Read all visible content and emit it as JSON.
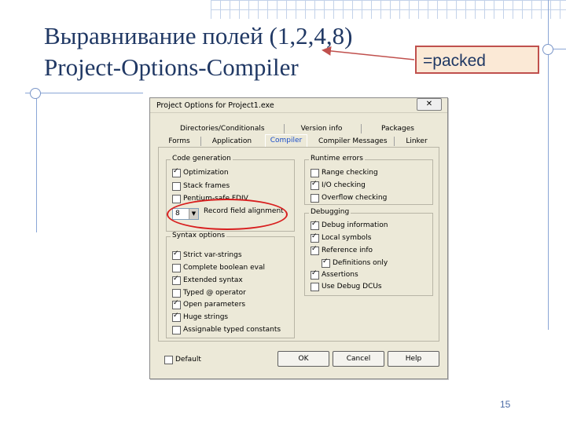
{
  "slide": {
    "title_line1": "Выравнивание полей (1,2,4,8)",
    "title_line2": "Project-Options-Compiler",
    "callout": "=packed",
    "page_number": "15",
    "colors": {
      "title": "#203864",
      "callout_border": "#c0504d",
      "callout_fill": "#fbe9d6",
      "highlight": "#d81e1e"
    }
  },
  "dialog": {
    "title": "Project Options for Project1.exe",
    "close_label": "✕",
    "tabs_row1": [
      "Directories/Conditionals",
      "Version info",
      "Packages"
    ],
    "tabs_row2": [
      "Forms",
      "Application",
      "Compiler",
      "Compiler Messages",
      "Linker"
    ],
    "active_tab": "Compiler",
    "code_generation": {
      "title": "Code generation",
      "items": [
        {
          "label": "Optimization",
          "checked": true
        },
        {
          "label": "Stack frames",
          "checked": false
        },
        {
          "label": "Pentium-safe FDIV",
          "checked": false
        }
      ],
      "alignment_value": "8",
      "alignment_label": "Record field alignment"
    },
    "syntax_options": {
      "title": "Syntax options",
      "items": [
        {
          "label": "Strict var-strings",
          "checked": true
        },
        {
          "label": "Complete boolean eval",
          "checked": false
        },
        {
          "label": "Extended syntax",
          "checked": true
        },
        {
          "label": "Typed @ operator",
          "checked": false
        },
        {
          "label": "Open parameters",
          "checked": true
        },
        {
          "label": "Huge strings",
          "checked": true
        },
        {
          "label": "Assignable typed constants",
          "checked": false
        }
      ]
    },
    "runtime_errors": {
      "title": "Runtime errors",
      "items": [
        {
          "label": "Range checking",
          "checked": false
        },
        {
          "label": "I/O checking",
          "checked": true
        },
        {
          "label": "Overflow checking",
          "checked": false
        }
      ]
    },
    "debugging": {
      "title": "Debugging",
      "items": [
        {
          "label": "Debug information",
          "checked": true
        },
        {
          "label": "Local symbols",
          "checked": true
        },
        {
          "label": "Reference info",
          "checked": true
        },
        {
          "label": "Definitions only",
          "checked": true
        },
        {
          "label": "Assertions",
          "checked": true
        },
        {
          "label": "Use Debug DCUs",
          "checked": false
        }
      ]
    },
    "default_checkbox": {
      "label": "Default",
      "checked": false
    },
    "buttons": {
      "ok": "OK",
      "cancel": "Cancel",
      "help": "Help"
    }
  }
}
